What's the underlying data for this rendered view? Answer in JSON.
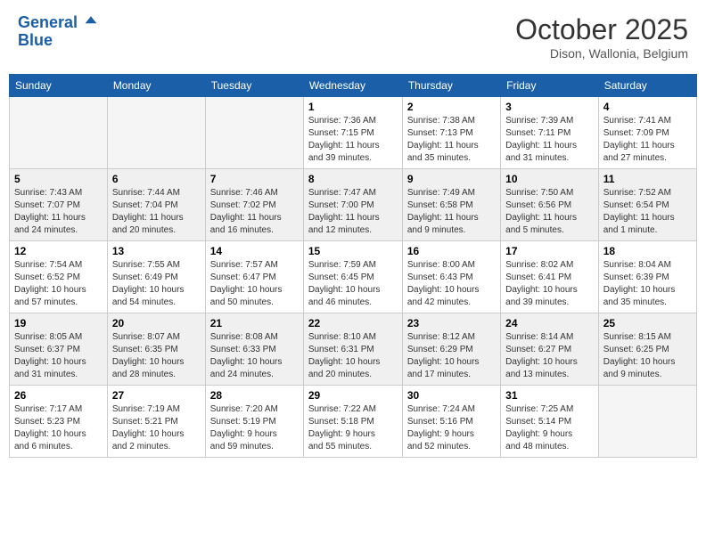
{
  "header": {
    "logo_line1": "General",
    "logo_line2": "Blue",
    "month": "October 2025",
    "location": "Dison, Wallonia, Belgium"
  },
  "weekdays": [
    "Sunday",
    "Monday",
    "Tuesday",
    "Wednesday",
    "Thursday",
    "Friday",
    "Saturday"
  ],
  "weeks": [
    [
      {
        "day": "",
        "info": ""
      },
      {
        "day": "",
        "info": ""
      },
      {
        "day": "",
        "info": ""
      },
      {
        "day": "1",
        "info": "Sunrise: 7:36 AM\nSunset: 7:15 PM\nDaylight: 11 hours\nand 39 minutes."
      },
      {
        "day": "2",
        "info": "Sunrise: 7:38 AM\nSunset: 7:13 PM\nDaylight: 11 hours\nand 35 minutes."
      },
      {
        "day": "3",
        "info": "Sunrise: 7:39 AM\nSunset: 7:11 PM\nDaylight: 11 hours\nand 31 minutes."
      },
      {
        "day": "4",
        "info": "Sunrise: 7:41 AM\nSunset: 7:09 PM\nDaylight: 11 hours\nand 27 minutes."
      }
    ],
    [
      {
        "day": "5",
        "info": "Sunrise: 7:43 AM\nSunset: 7:07 PM\nDaylight: 11 hours\nand 24 minutes."
      },
      {
        "day": "6",
        "info": "Sunrise: 7:44 AM\nSunset: 7:04 PM\nDaylight: 11 hours\nand 20 minutes."
      },
      {
        "day": "7",
        "info": "Sunrise: 7:46 AM\nSunset: 7:02 PM\nDaylight: 11 hours\nand 16 minutes."
      },
      {
        "day": "8",
        "info": "Sunrise: 7:47 AM\nSunset: 7:00 PM\nDaylight: 11 hours\nand 12 minutes."
      },
      {
        "day": "9",
        "info": "Sunrise: 7:49 AM\nSunset: 6:58 PM\nDaylight: 11 hours\nand 9 minutes."
      },
      {
        "day": "10",
        "info": "Sunrise: 7:50 AM\nSunset: 6:56 PM\nDaylight: 11 hours\nand 5 minutes."
      },
      {
        "day": "11",
        "info": "Sunrise: 7:52 AM\nSunset: 6:54 PM\nDaylight: 11 hours\nand 1 minute."
      }
    ],
    [
      {
        "day": "12",
        "info": "Sunrise: 7:54 AM\nSunset: 6:52 PM\nDaylight: 10 hours\nand 57 minutes."
      },
      {
        "day": "13",
        "info": "Sunrise: 7:55 AM\nSunset: 6:49 PM\nDaylight: 10 hours\nand 54 minutes."
      },
      {
        "day": "14",
        "info": "Sunrise: 7:57 AM\nSunset: 6:47 PM\nDaylight: 10 hours\nand 50 minutes."
      },
      {
        "day": "15",
        "info": "Sunrise: 7:59 AM\nSunset: 6:45 PM\nDaylight: 10 hours\nand 46 minutes."
      },
      {
        "day": "16",
        "info": "Sunrise: 8:00 AM\nSunset: 6:43 PM\nDaylight: 10 hours\nand 42 minutes."
      },
      {
        "day": "17",
        "info": "Sunrise: 8:02 AM\nSunset: 6:41 PM\nDaylight: 10 hours\nand 39 minutes."
      },
      {
        "day": "18",
        "info": "Sunrise: 8:04 AM\nSunset: 6:39 PM\nDaylight: 10 hours\nand 35 minutes."
      }
    ],
    [
      {
        "day": "19",
        "info": "Sunrise: 8:05 AM\nSunset: 6:37 PM\nDaylight: 10 hours\nand 31 minutes."
      },
      {
        "day": "20",
        "info": "Sunrise: 8:07 AM\nSunset: 6:35 PM\nDaylight: 10 hours\nand 28 minutes."
      },
      {
        "day": "21",
        "info": "Sunrise: 8:08 AM\nSunset: 6:33 PM\nDaylight: 10 hours\nand 24 minutes."
      },
      {
        "day": "22",
        "info": "Sunrise: 8:10 AM\nSunset: 6:31 PM\nDaylight: 10 hours\nand 20 minutes."
      },
      {
        "day": "23",
        "info": "Sunrise: 8:12 AM\nSunset: 6:29 PM\nDaylight: 10 hours\nand 17 minutes."
      },
      {
        "day": "24",
        "info": "Sunrise: 8:14 AM\nSunset: 6:27 PM\nDaylight: 10 hours\nand 13 minutes."
      },
      {
        "day": "25",
        "info": "Sunrise: 8:15 AM\nSunset: 6:25 PM\nDaylight: 10 hours\nand 9 minutes."
      }
    ],
    [
      {
        "day": "26",
        "info": "Sunrise: 7:17 AM\nSunset: 5:23 PM\nDaylight: 10 hours\nand 6 minutes."
      },
      {
        "day": "27",
        "info": "Sunrise: 7:19 AM\nSunset: 5:21 PM\nDaylight: 10 hours\nand 2 minutes."
      },
      {
        "day": "28",
        "info": "Sunrise: 7:20 AM\nSunset: 5:19 PM\nDaylight: 9 hours\nand 59 minutes."
      },
      {
        "day": "29",
        "info": "Sunrise: 7:22 AM\nSunset: 5:18 PM\nDaylight: 9 hours\nand 55 minutes."
      },
      {
        "day": "30",
        "info": "Sunrise: 7:24 AM\nSunset: 5:16 PM\nDaylight: 9 hours\nand 52 minutes."
      },
      {
        "day": "31",
        "info": "Sunrise: 7:25 AM\nSunset: 5:14 PM\nDaylight: 9 hours\nand 48 minutes."
      },
      {
        "day": "",
        "info": ""
      }
    ]
  ]
}
